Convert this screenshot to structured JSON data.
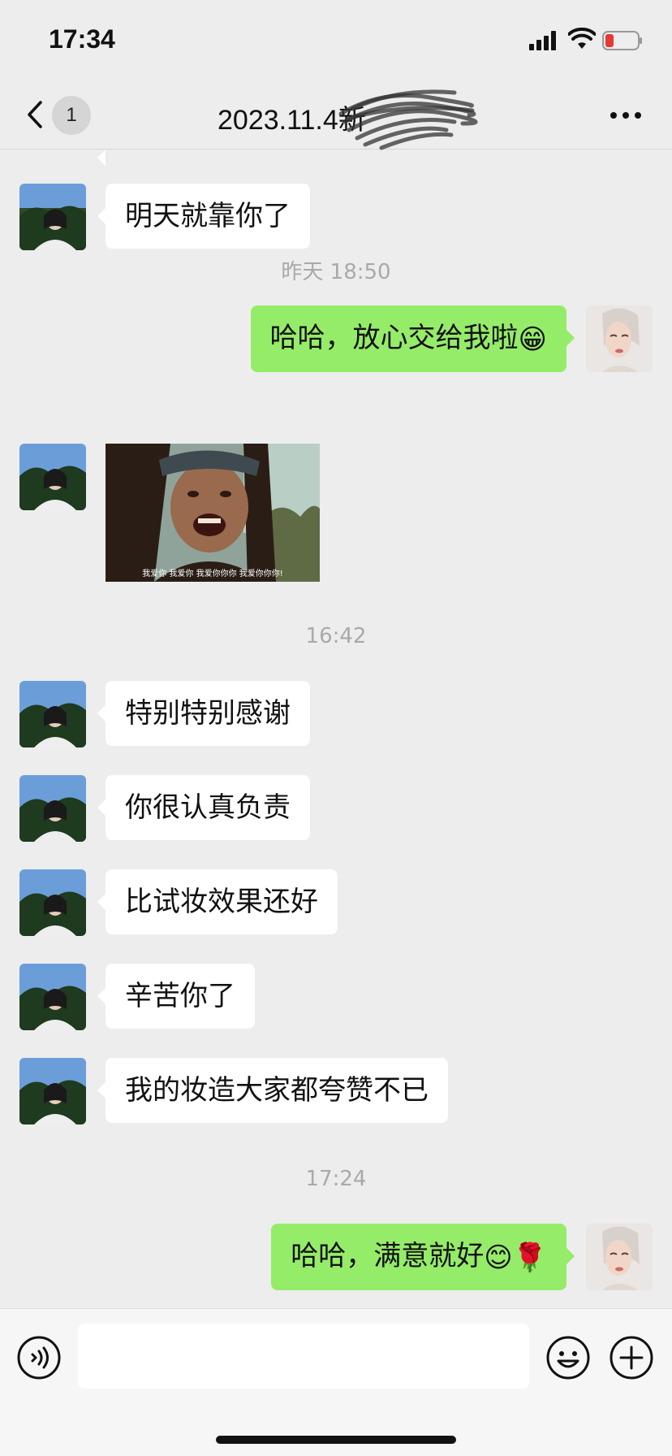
{
  "status_bar": {
    "time": "17:34",
    "icons": [
      "signal-icon",
      "wifi-icon",
      "battery-low-icon"
    ],
    "battery_color": "#e53935"
  },
  "nav": {
    "title": "2023.11.4新",
    "unread_count": "1",
    "back_icon": "chevron-left-icon",
    "more_icon": "more-dots-icon"
  },
  "messages": {
    "m1": "明天就靠你了",
    "ts1": "昨天 18:50",
    "m2": "哈哈，放心交给我啦",
    "m2_emoji": "😁",
    "sticker_caption": "我爱你  我爱你  我爱你你你  我爱你你你!",
    "ts2": "16:42",
    "m3": "特别特别感谢",
    "m4": "你很认真负责",
    "m5": "比试妆效果还好",
    "m6": "辛苦你了",
    "m7": "我的妆造大家都夸赞不已",
    "ts3": "17:24",
    "m8": "哈哈，满意就好",
    "m8_emoji": "😊🌹"
  },
  "input_bar": {
    "placeholder": "",
    "icons": [
      "voice-icon",
      "emoji-icon",
      "plus-icon"
    ]
  },
  "colors": {
    "background": "#ededed",
    "outgoing_bubble": "#95ec69",
    "incoming_bubble": "#ffffff",
    "timestamp": "#a9a9a9"
  }
}
